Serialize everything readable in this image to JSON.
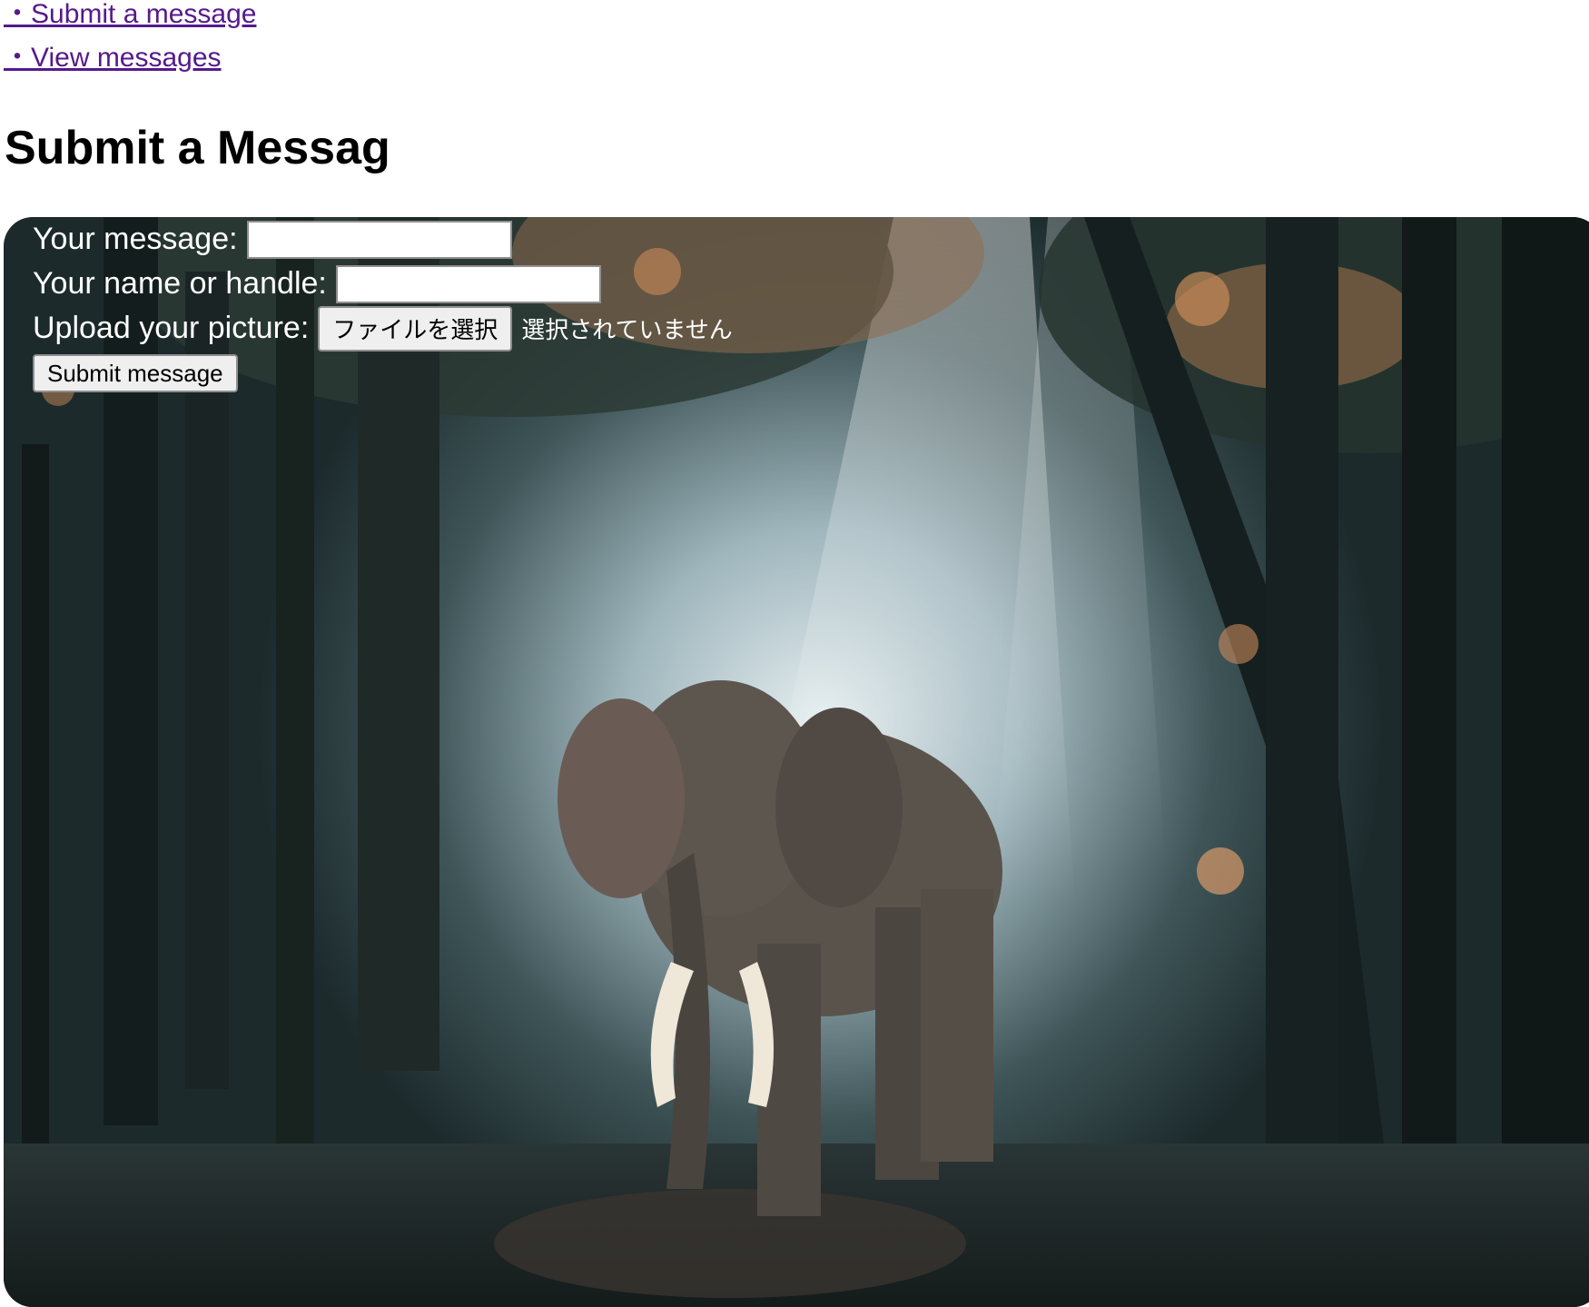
{
  "nav": {
    "links": [
      {
        "label": "・Submit a message"
      },
      {
        "label": "・View messages"
      }
    ]
  },
  "page": {
    "title": "Submit a Messag"
  },
  "form": {
    "message_label": "Your message:",
    "message_value": "",
    "name_label": "Your name or handle:",
    "name_value": "",
    "picture_label": "Upload your picture:",
    "file_button_label": "ファイルを選択",
    "file_status": "選択されていません",
    "submit_label": "Submit message"
  },
  "background": {
    "subject": "elephant-in-misty-forest",
    "colors": {
      "forest_dark": "#1c2a2c",
      "mist": "#c9d8dc",
      "foliage_orange": "#c98a5a",
      "elephant": "#5a534c",
      "tusk": "#efe7d8"
    }
  },
  "colors": {
    "link": "#551a8b",
    "form_text": "#ffffff",
    "button_bg": "#efefef"
  }
}
